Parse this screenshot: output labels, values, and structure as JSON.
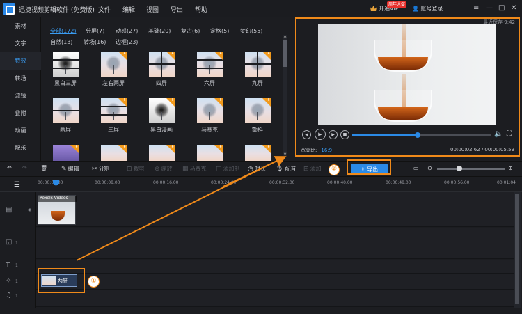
{
  "app": {
    "title": "迅捷视频剪辑软件 (免费版)",
    "menus": [
      "文件",
      "编辑",
      "视图",
      "导出",
      "帮助"
    ],
    "vip_label": "开通VIP",
    "vip_badge": "周年大促",
    "login_label": "账号登录",
    "window_controls": [
      "≡",
      "—",
      "□",
      "✕"
    ]
  },
  "sidebar": {
    "items": [
      "素材",
      "文字",
      "特效",
      "转场",
      "滤镜",
      "叠附",
      "动画",
      "配乐"
    ],
    "active": "特效"
  },
  "effects": {
    "categories_row1": [
      "全部(172)",
      "分屏(7)",
      "动感(27)",
      "基础(20)",
      "复古(6)",
      "定格(5)",
      "梦幻(55)"
    ],
    "categories_row2": [
      "自然(13)",
      "转场(16)",
      "边框(23)"
    ],
    "items": [
      "黑白三屏",
      "左右两屏",
      "四屏",
      "六屏",
      "九屏",
      "两屏",
      "三屏",
      "黑白漫画",
      "马赛克",
      "颤抖"
    ]
  },
  "preview": {
    "autosave": "最近保存 9:42",
    "aspect_label": "宽高比:",
    "aspect_value": "16:9",
    "timecode": "00:00:02.62 / 00:00:05.59",
    "progress": 0.47
  },
  "toolbar": {
    "edit": "编辑",
    "split": "分割",
    "crop": "裁剪",
    "zoom": "缩放",
    "mosaic": "马赛克",
    "freeze": "添加制",
    "duration": "时长",
    "voiceover": "配音",
    "more": "添加",
    "export": "导出"
  },
  "timeline": {
    "ticks": [
      "00:00:00.00",
      "00:00:08.00",
      "00:00:16.00",
      "00:00:24.00",
      "00:00:32.00",
      "00:00:40.00",
      "00:00:48.00",
      "00:00:56.00",
      "00:01:04"
    ],
    "video_clip_name": "Pexels Videos",
    "effect_clip_label": "两屏",
    "track_meta": "1"
  },
  "callouts": {
    "step1": "①",
    "step2": "②"
  },
  "colors": {
    "accent_blue": "#2b8ae6",
    "callout_orange": "#f08a1a"
  }
}
